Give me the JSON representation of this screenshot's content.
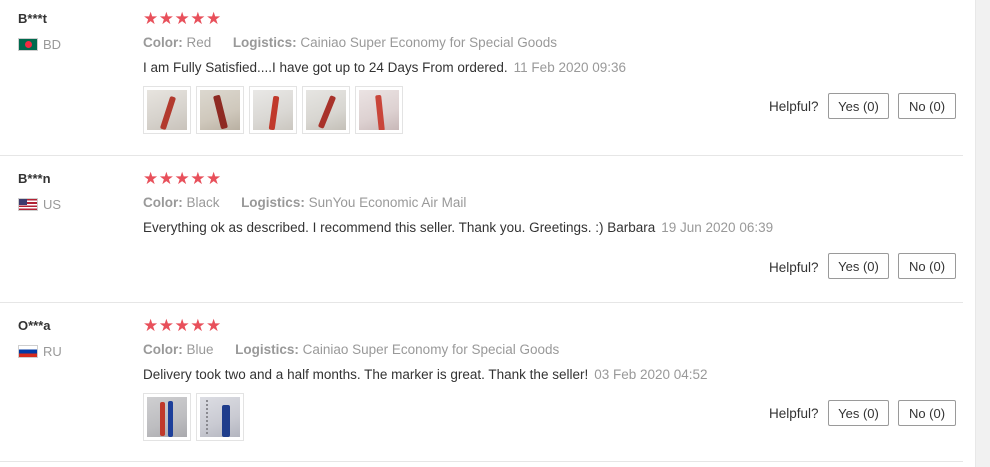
{
  "reviews": [
    {
      "user": "B***t",
      "country": "BD",
      "flag_colors": [
        "#006a4e",
        "#f42a41"
      ],
      "stars": "★★★★★",
      "color_label": "Color:",
      "color_value": "Red",
      "logistics_label": "Logistics:",
      "logistics_value": "Cainiao Super Economy for Special Goods",
      "text": "I am Fully Satisfied....I have got up to 24 Days From ordered.",
      "date": "11 Feb 2020 09:36",
      "photos": [
        "marker-photo",
        "marker-photo",
        "marker-photo",
        "marker-photo",
        "marker-photo"
      ],
      "helpful_label": "Helpful?",
      "yes_label": "Yes (0)",
      "no_label": "No (0)"
    },
    {
      "user": "B***n",
      "country": "US",
      "flag_colors": [
        "#b22234",
        "#3c3b6e"
      ],
      "stars": "★★★★★",
      "color_label": "Color:",
      "color_value": "Black",
      "logistics_label": "Logistics:",
      "logistics_value": "SunYou Economic Air Mail",
      "text": "Everything ok as described. I recommend this seller. Thank you. Greetings. :) Barbara",
      "date": "19 Jun 2020 06:39",
      "photos": [],
      "helpful_label": "Helpful?",
      "yes_label": "Yes (0)",
      "no_label": "No (0)"
    },
    {
      "user": "O***a",
      "country": "RU",
      "flag_colors": [
        "#ffffff",
        "#0039a6",
        "#d52b1e"
      ],
      "stars": "★★★★★",
      "color_label": "Color:",
      "color_value": "Blue",
      "logistics_label": "Logistics:",
      "logistics_value": "Cainiao Super Economy for Special Goods",
      "text": "Delivery took two and a half months. The marker is great. Thank the seller!",
      "date": "03 Feb 2020 04:52",
      "photos": [
        "marker-photo",
        "marker-photo"
      ],
      "helpful_label": "Helpful?",
      "yes_label": "Yes (0)",
      "no_label": "No (0)"
    }
  ],
  "colors": {
    "star": "#e8505b",
    "muted": "#999999",
    "text": "#333333",
    "divider": "#e6e6e6"
  }
}
